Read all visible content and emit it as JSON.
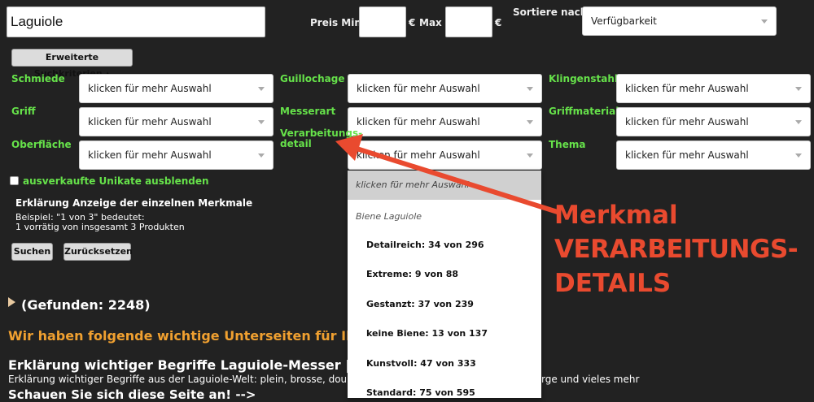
{
  "search": {
    "query": "Laguiole"
  },
  "price": {
    "min_label": "Preis Min",
    "currency": "€",
    "max_label": "Max",
    "currency2": "€"
  },
  "sort": {
    "label": "Sortiere nach",
    "value": "Verfügbarkeit"
  },
  "advanced_button": "Erweiterte Suchkriterien ▴",
  "filters": [
    {
      "label": "Schmiede",
      "value": "klicken für mehr Auswahl"
    },
    {
      "label": "Guillochage",
      "value": "klicken für mehr Auswahl"
    },
    {
      "label": "Klingenstahl",
      "value": "klicken für mehr Auswahl"
    },
    {
      "label": "Griff",
      "value": "klicken für mehr Auswahl"
    },
    {
      "label": "Messerart",
      "value": "klicken für mehr Auswahl"
    },
    {
      "label": "Griffmaterial",
      "value": "klicken für mehr Auswahl"
    },
    {
      "label": "Oberfläche",
      "value": "klicken für mehr Auswahl"
    },
    {
      "label": "Verarbeitungs-\ndetail",
      "value": "klicken für mehr Auswahl"
    },
    {
      "label": "Thema",
      "value": "klicken für mehr Auswahl"
    }
  ],
  "hide_sold": "ausverkaufte Unikate ausblenden",
  "explanation": {
    "title": "Erklärung Anzeige der einzelnen Merkmale",
    "line1": "Beispiel: \"1 von 3\" bedeutet:",
    "line2": "1 vorrätig von insgesamt 3 Produkten"
  },
  "buttons": {
    "search": "Suchen",
    "reset": "Zurücksetzen"
  },
  "found": "(Gefunden: 2248)",
  "subpages_heading": "Wir haben folgende wichtige Unterseiten für Ihre Such",
  "article": {
    "title": "Erklärung wichtiger Begriffe Laguiole-Messer | origina",
    "desc_left": "Erklärung wichtiger Begriffe aus der Laguiole-Welt: plein, brosse, double",
    "desc_right": "rge und vieles mehr",
    "cta": "Schauen Sie sich diese Seite an! -->"
  },
  "dropdown": {
    "placeholder": "klicken für mehr Auswahl",
    "group": "Biene Laguiole",
    "options": [
      "Detailreich: 34 von 296",
      "Extreme: 9 von 88",
      "Gestanzt: 37 von 239",
      "keine Biene: 13 von 137",
      "Kunstvoll: 47 von 333",
      "Standard: 75 von 595"
    ]
  },
  "annotation": {
    "line1": "Merkmal",
    "line2": "VERARBEITUNGS-",
    "line3": "DETAILS"
  },
  "colors": {
    "background": "#222222",
    "label_green": "#66e24a",
    "heading_orange": "#f0a030",
    "annotation_red": "#e94a2f"
  }
}
